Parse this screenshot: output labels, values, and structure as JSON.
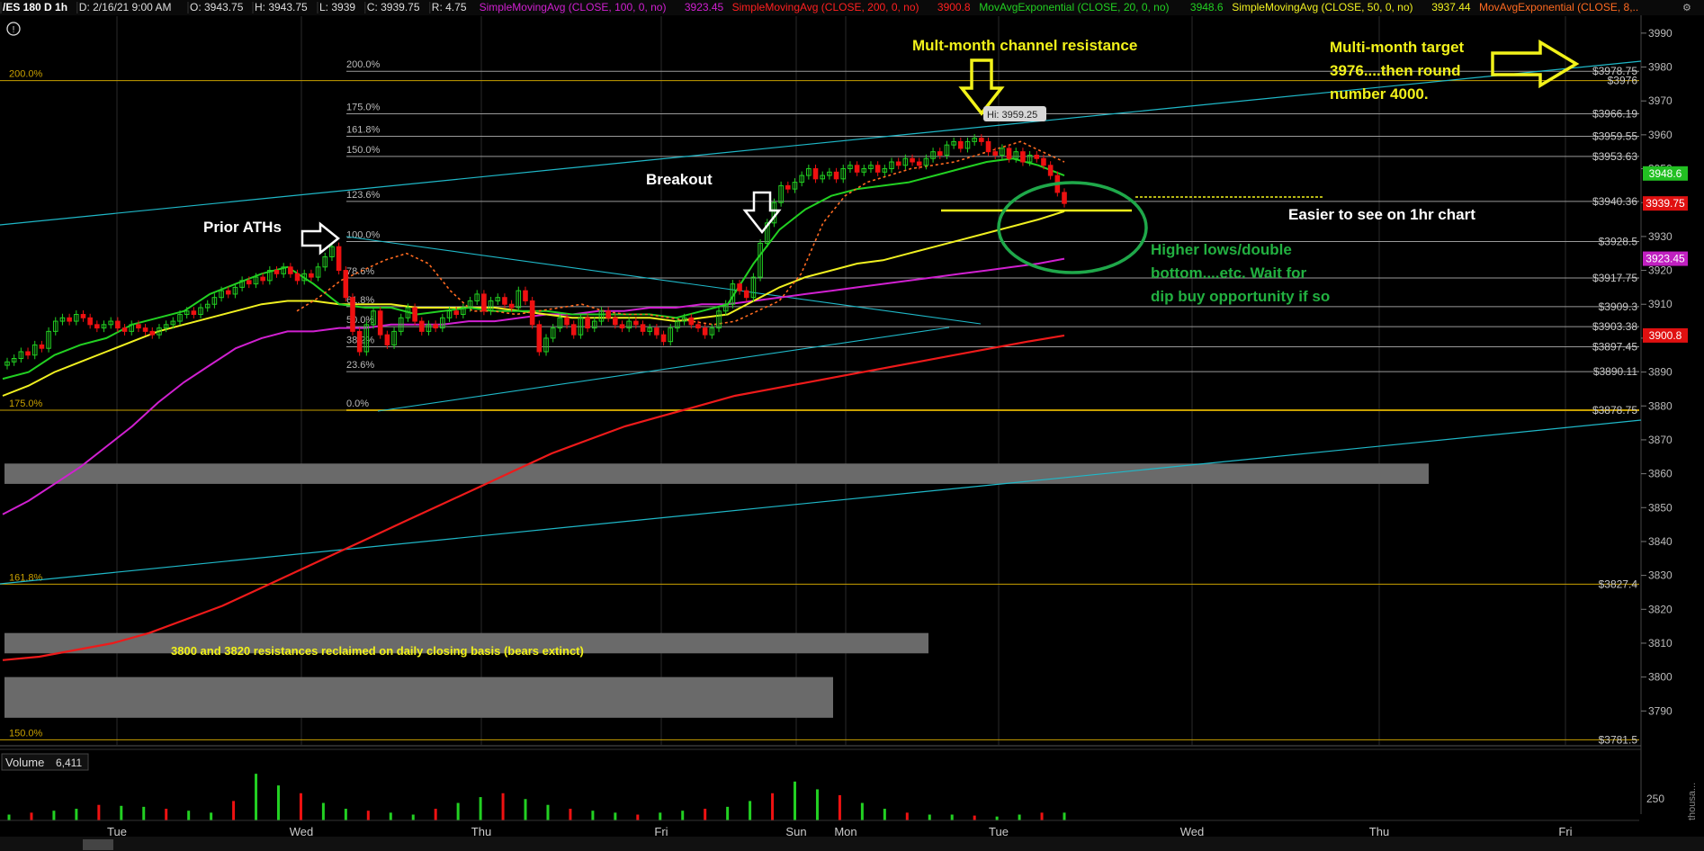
{
  "header": {
    "symbol": "/ES 180 D 1h",
    "date": "D: 2/16/21 9:00 AM",
    "open": "O: 3943.75",
    "high": "H: 3943.75",
    "low": "L: 3939",
    "close": "C: 3939.75",
    "range": "R: 4.75",
    "studies": [
      {
        "name": "SimpleMovingAvg (CLOSE, 100, 0, no)",
        "value": "3923.45",
        "color": "#d020d0"
      },
      {
        "name": "SimpleMovingAvg (CLOSE, 200, 0, no)",
        "value": "3900.8",
        "color": "#ff2020"
      },
      {
        "name": "MovAvgExponential (CLOSE, 20, 0, no)",
        "value": "3948.6",
        "color": "#22d022"
      },
      {
        "name": "SimpleMovingAvg (CLOSE, 50, 0, no)",
        "value": "3937.44",
        "color": "#f0f020"
      },
      {
        "name": "MovAvgExponential (CLOSE, 8,...",
        "value": "",
        "color": "#ff6a20"
      }
    ]
  },
  "volume": {
    "label": "Volume",
    "value": "6,411",
    "tick": "250",
    "unit_label": "thousa..."
  },
  "chart_data": {
    "type": "candlestick",
    "ylim": [
      3780,
      3995
    ],
    "y_ticks": [
      3790,
      3800,
      3810,
      3820,
      3830,
      3840,
      3850,
      3860,
      3870,
      3880,
      3890,
      3900,
      3910,
      3920,
      3930,
      3940,
      3950,
      3960,
      3970,
      3980,
      3990
    ],
    "x_labels": [
      "Tue",
      "Wed",
      "Thu",
      "Fri",
      "Sun",
      "Mon",
      "Tue",
      "Wed",
      "Thu",
      "Fri"
    ],
    "price_tags": [
      {
        "value": 3978.75,
        "text": "$3978.75"
      },
      {
        "value": 3976,
        "text": "$3976"
      },
      {
        "value": 3966.19,
        "text": "$3966.19"
      },
      {
        "value": 3959.55,
        "text": "$3959.55"
      },
      {
        "value": 3953.63,
        "text": "$3953.63"
      },
      {
        "value": 3940.36,
        "text": "$3940.36"
      },
      {
        "value": 3928.5,
        "text": "$3928.5"
      },
      {
        "value": 3917.75,
        "text": "$3917.75"
      },
      {
        "value": 3909.3,
        "text": "$3909.3"
      },
      {
        "value": 3903.38,
        "text": "$3903.38"
      },
      {
        "value": 3897.45,
        "text": "$3897.45"
      },
      {
        "value": 3890.11,
        "text": "$3890.11"
      },
      {
        "value": 3878.75,
        "text": "$3878.75"
      },
      {
        "value": 3827.4,
        "text": "$3827.4"
      },
      {
        "value": 3781.5,
        "text": "$3781.5"
      }
    ],
    "badges": [
      {
        "value": 3948.6,
        "text": "3948.6",
        "color": "#22c022"
      },
      {
        "value": 3939.75,
        "text": "3939.75",
        "color": "#e01010"
      },
      {
        "value": 3923.45,
        "text": "3923.45",
        "color": "#c020c0"
      },
      {
        "value": 3900.8,
        "text": "3900.8",
        "color": "#e01010"
      }
    ],
    "fib_levels": [
      {
        "label": "200.0%",
        "value": 3978.75
      },
      {
        "label": "175.0%",
        "value": 3966.19
      },
      {
        "label": "161.8%",
        "value": 3959.55
      },
      {
        "label": "150.0%",
        "value": 3953.63
      },
      {
        "label": "123.6%",
        "value": 3940.36
      },
      {
        "label": "100.0%",
        "value": 3928.5
      },
      {
        "label": "78.6%",
        "value": 3917.75
      },
      {
        "label": "61.8%",
        "value": 3909.3
      },
      {
        "label": "50.0%",
        "value": 3903.38
      },
      {
        "label": "38.2%",
        "value": 3897.45
      },
      {
        "label": "23.6%",
        "value": 3890.11
      },
      {
        "label": "0.0%",
        "value": 3878.75
      }
    ],
    "wide_fib_levels": [
      {
        "label": "200.0%",
        "value": 3976
      },
      {
        "label": "175.0%",
        "value": 3878.75
      },
      {
        "label": "161.8%",
        "value": 3827.4
      },
      {
        "label": "150.0%",
        "value": 3781.5
      }
    ],
    "zones": [
      {
        "from": 3857,
        "to": 3863
      },
      {
        "from": 3807,
        "to": 3813
      },
      {
        "from": 3788,
        "to": 3800
      }
    ],
    "high_marker": {
      "text": "Hi: 3959.25",
      "value": 3959.25
    },
    "closes": [
      3893,
      3894,
      3896,
      3895,
      3898,
      3897,
      3902,
      3905,
      3906,
      3905,
      3907,
      3906,
      3904,
      3903,
      3904,
      3905,
      3903,
      3902,
      3904,
      3903,
      3902,
      3901,
      3903,
      3904,
      3905,
      3907,
      3908,
      3907,
      3909,
      3910,
      3912,
      3914,
      3913,
      3915,
      3917,
      3916,
      3918,
      3917,
      3920,
      3919,
      3921,
      3919,
      3917,
      3919,
      3918,
      3921,
      3924,
      3927,
      3920,
      3912,
      3902,
      3896,
      3904,
      3908,
      3901,
      3898,
      3902,
      3906,
      3909,
      3905,
      3902,
      3904,
      3903,
      3906,
      3908,
      3907,
      3909,
      3911,
      3913,
      3908,
      3911,
      3912,
      3910,
      3909,
      3914,
      3911,
      3904,
      3896,
      3900,
      3903,
      3906,
      3904,
      3901,
      3906,
      3903,
      3905,
      3908,
      3906,
      3904,
      3903,
      3905,
      3904,
      3902,
      3903,
      3901,
      3899,
      3903,
      3905,
      3906,
      3904,
      3903,
      3901,
      3903,
      3908,
      3910,
      3916,
      3914,
      3912,
      3918,
      3928,
      3934,
      3940,
      3945,
      3944,
      3946,
      3948,
      3950,
      3947,
      3948,
      3949,
      3947,
      3950,
      3951,
      3949,
      3950,
      3951,
      3949,
      3950,
      3952,
      3951,
      3953,
      3952,
      3951,
      3953,
      3955,
      3954,
      3957,
      3958,
      3956,
      3958,
      3959,
      3958,
      3955,
      3954,
      3956,
      3953,
      3955,
      3952,
      3954,
      3953,
      3951,
      3948,
      3943,
      3939.75
    ],
    "ema20": [
      3888,
      3890,
      3895,
      3898,
      3900,
      3904,
      3906,
      3908,
      3913,
      3916,
      3919,
      3921,
      3916,
      3910,
      3909,
      3909,
      3907,
      3908,
      3909,
      3908,
      3908,
      3908,
      3907,
      3907,
      3907,
      3907,
      3906,
      3908,
      3910,
      3922,
      3932,
      3938,
      3942,
      3944,
      3945,
      3946,
      3948,
      3950,
      3952,
      3953,
      3951,
      3948
    ],
    "sma50": [
      3883,
      3886,
      3890,
      3893,
      3896,
      3899,
      3902,
      3904,
      3906,
      3908,
      3910,
      3911,
      3911,
      3910,
      3910,
      3910,
      3909,
      3909,
      3909,
      3909,
      3908,
      3907,
      3906,
      3906,
      3906,
      3906,
      3905,
      3906,
      3907,
      3911,
      3915,
      3918,
      3920,
      3922,
      3923,
      3925,
      3927,
      3929,
      3931,
      3933,
      3935,
      3937.44
    ],
    "ema8": [
      3908,
      3912,
      3917,
      3920,
      3923,
      3925,
      3922,
      3914,
      3908,
      3908,
      3907,
      3908,
      3909,
      3910,
      3908,
      3907,
      3907,
      3906,
      3905,
      3904,
      3905,
      3908,
      3911,
      3919,
      3934,
      3942,
      3946,
      3948,
      3950,
      3951,
      3952,
      3954,
      3956,
      3958,
      3955,
      3952
    ],
    "sma100": [
      3848,
      3852,
      3857,
      3862,
      3868,
      3874,
      3881,
      3887,
      3892,
      3897,
      3900,
      3902,
      3902,
      3903,
      3903,
      3904,
      3904,
      3904,
      3905,
      3905,
      3906,
      3907,
      3907,
      3908,
      3908,
      3909,
      3909,
      3910,
      3910,
      3911,
      3912,
      3913,
      3914,
      3915,
      3916,
      3917,
      3918,
      3919,
      3920,
      3921,
      3922,
      3923.45
    ],
    "sma200": [
      3805,
      3806,
      3808,
      3810,
      3813,
      3817,
      3821,
      3826,
      3831,
      3836,
      3841,
      3846,
      3851,
      3856,
      3861,
      3866,
      3870,
      3874,
      3877,
      3880,
      3883,
      3885,
      3887,
      3889,
      3891,
      3893,
      3895,
      3897,
      3899,
      3900.8
    ],
    "volume": [
      30,
      40,
      50,
      60,
      80,
      75,
      70,
      60,
      50,
      40,
      100,
      240,
      180,
      140,
      90,
      60,
      50,
      40,
      30,
      60,
      90,
      120,
      140,
      110,
      80,
      60,
      50,
      40,
      30,
      40,
      50,
      60,
      70,
      100,
      140,
      200,
      160,
      130,
      90,
      60,
      40,
      30,
      30,
      25,
      20,
      30,
      40,
      40
    ]
  },
  "annotations": {
    "prior_aths": "Prior ATHs",
    "breakout": "Breakout",
    "channel_resistance": "Mult-month channel resistance",
    "target_1": "Multi-month target",
    "target_2": "3976....then round",
    "target_3": "number 4000.",
    "easier": "Easier to see on 1hr chart",
    "higher_lows_1": "Higher lows/double",
    "higher_lows_2": "bottom....etc. Wait for",
    "higher_lows_3": "dip buy opportunity if so",
    "reclaimed": "3800 and 3820 resistances reclaimed on daily closing basis (bears extinct)"
  },
  "colors": {
    "background": "#000000",
    "grid": "#2a2a2a",
    "fib": "#9a9a9a",
    "fib_gold": "#c8a000",
    "channel": "#1fb8c8",
    "annotation_yellow": "#f2f21a",
    "annotation_white": "#ffffff",
    "annotation_green": "#22b040",
    "bull": "#22d022",
    "bear": "#ee1111"
  }
}
